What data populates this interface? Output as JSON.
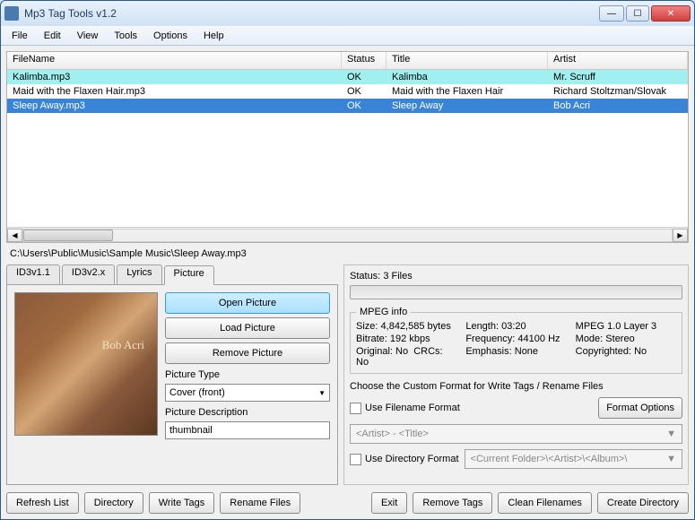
{
  "window": {
    "title": "Mp3 Tag Tools v1.2"
  },
  "menu": [
    "File",
    "Edit",
    "View",
    "Tools",
    "Options",
    "Help"
  ],
  "columns": {
    "filename": "FileName",
    "status": "Status",
    "title": "Title",
    "artist": "Artist"
  },
  "rows": [
    {
      "file": "Kalimba.mp3",
      "status": "OK",
      "title": "Kalimba",
      "artist": "Mr. Scruff",
      "class": "hl"
    },
    {
      "file": "Maid with the Flaxen Hair.mp3",
      "status": "OK",
      "title": "Maid with the Flaxen Hair",
      "artist": "Richard Stoltzman/Slovak"
    },
    {
      "file": "Sleep Away.mp3",
      "status": "OK",
      "title": "Sleep Away",
      "artist": "Bob Acri",
      "class": "sel"
    }
  ],
  "path": "C:\\Users\\Public\\Music\\Sample Music\\Sleep Away.mp3",
  "tabs": {
    "id3v1": "ID3v1.1",
    "id3v2": "ID3v2.x",
    "lyrics": "Lyrics",
    "picture": "Picture"
  },
  "picture": {
    "open": "Open Picture",
    "load": "Load Picture",
    "remove": "Remove Picture",
    "type_label": "Picture Type",
    "type_value": "Cover (front)",
    "desc_label": "Picture Description",
    "desc_value": "thumbnail"
  },
  "status": {
    "label": "Status:",
    "text": "3 Files"
  },
  "mpeg": {
    "legend": "MPEG info",
    "size_l": "Size:",
    "size_v": "4,842,585 bytes",
    "length_l": "Length:",
    "length_v": "03:20",
    "version_l": "",
    "version_v": "MPEG 1.0 Layer 3",
    "bitrate_l": "Bitrate:",
    "bitrate_v": "192 kbps",
    "freq_l": "Frequency:",
    "freq_v": "44100 Hz",
    "mode_l": "Mode:",
    "mode_v": "Stereo",
    "orig_l": "Original:",
    "orig_v": "No",
    "crc_l": "CRCs:",
    "crc_v": "No",
    "emph_l": "Emphasis:",
    "emph_v": "None",
    "copy_l": "Copyrighted:",
    "copy_v": "No"
  },
  "format": {
    "heading": "Choose the Custom Format for Write Tags / Rename Files",
    "use_filename": "Use Filename Format",
    "format_options": "Format Options",
    "filename_pattern": "<Artist> - <Title>",
    "use_directory": "Use Directory Format",
    "directory_pattern": "<Current Folder>\\<Artist>\\<Album>\\"
  },
  "buttons": {
    "refresh": "Refresh List",
    "directory": "Directory",
    "write": "Write Tags",
    "rename": "Rename Files",
    "exit": "Exit",
    "remove_tags": "Remove Tags",
    "clean": "Clean Filenames",
    "create_dir": "Create Directory"
  }
}
